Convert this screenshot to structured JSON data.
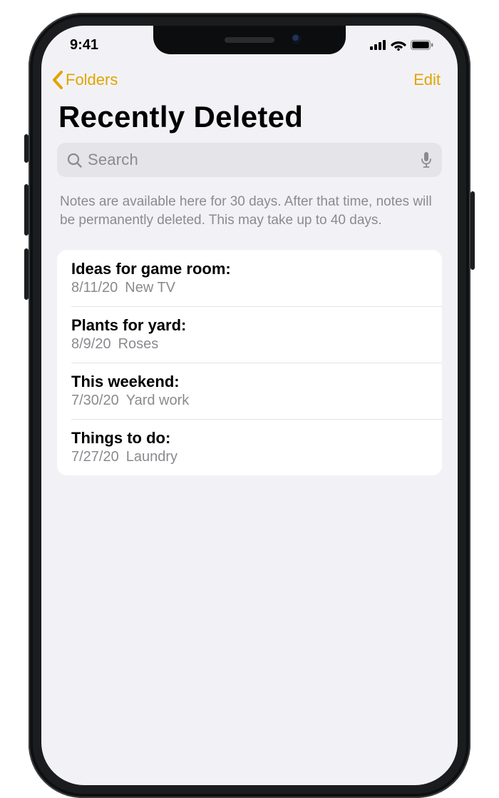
{
  "status": {
    "time": "9:41"
  },
  "nav": {
    "back_label": "Folders",
    "edit_label": "Edit"
  },
  "page_title": "Recently Deleted",
  "search": {
    "placeholder": "Search"
  },
  "info_text": "Notes are available here for 30 days. After that time, notes will be permanently deleted. This may take up to 40 days.",
  "notes": [
    {
      "title": "Ideas for game room:",
      "date": "8/11/20",
      "preview": "New TV"
    },
    {
      "title": "Plants for yard:",
      "date": "8/9/20",
      "preview": "Roses"
    },
    {
      "title": "This weekend:",
      "date": "7/30/20",
      "preview": "Yard work"
    },
    {
      "title": "Things to do:",
      "date": "7/27/20",
      "preview": "Laundry"
    }
  ],
  "colors": {
    "accent": "#e1a400",
    "background": "#f2f2f6",
    "secondary_text": "#8a8a8f"
  }
}
